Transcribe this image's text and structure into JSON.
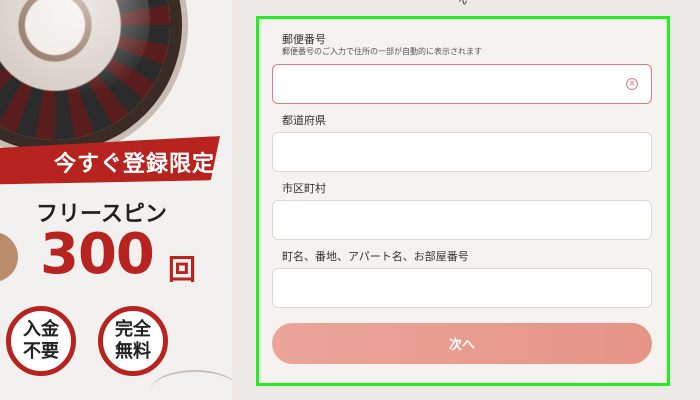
{
  "promo": {
    "ribbon_text": "今すぐ登録限定",
    "subtitle": "フリースピン",
    "number": "300",
    "unit": "回",
    "badges": [
      "入金\n不要",
      "完全\n無料"
    ]
  },
  "form": {
    "postal_label": "郵便番号",
    "postal_hint": "郵便番号のご入力で住所の一部が自動的に表示されます",
    "postal_value": "",
    "prefecture_label": "都道府県",
    "prefecture_value": "",
    "city_label": "市区町村",
    "city_value": "",
    "address_label": "町名、番地、アパート名、お部屋番号",
    "address_value": "",
    "next_label": "次へ"
  },
  "colors": {
    "accent_red": "#b7231f",
    "focus_border": "#e07a84",
    "button": "#e9a095",
    "highlight": "#22ee22"
  }
}
